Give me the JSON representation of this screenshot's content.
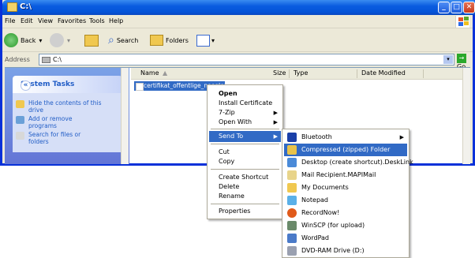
{
  "window": {
    "title": "C:\\",
    "colors": {
      "titlebar": "#0a5ce0",
      "selection": "#316ac5",
      "task_link": "#215dc6"
    }
  },
  "menu": [
    "File",
    "Edit",
    "View",
    "Favorites",
    "Tools",
    "Help"
  ],
  "toolbar": {
    "back": "Back",
    "search": "Search",
    "folders": "Folders"
  },
  "address": {
    "label": "Address",
    "value": "C:\\",
    "go": "Go"
  },
  "tasks": {
    "header": "System Tasks",
    "items": [
      {
        "label": "Hide the contents of this drive",
        "icon": "folder-icon"
      },
      {
        "label": "Add or remove programs",
        "icon": "programs-icon"
      },
      {
        "label": "Search for files or folders",
        "icon": "search-icon"
      }
    ]
  },
  "columns": [
    "Name",
    "Size",
    "Type",
    "Date Modified"
  ],
  "file": {
    "name": "certifikat_offentlige_noegler.cer"
  },
  "context_menu": {
    "items": [
      "Open",
      "Install Certificate",
      "7-Zip",
      "Open With",
      "Send To",
      "Cut",
      "Copy",
      "Create Shortcut",
      "Delete",
      "Rename",
      "Properties"
    ]
  },
  "send_to": {
    "items": [
      {
        "label": "Bluetooth",
        "icon": "bluetooth-icon",
        "color": "#1a3fa8"
      },
      {
        "label": "Compressed (zipped) Folder",
        "icon": "zip-folder-icon",
        "color": "#e8c24a"
      },
      {
        "label": "Desktop (create shortcut).DeskLink",
        "icon": "desktop-icon",
        "color": "#4a8ad8"
      },
      {
        "label": "Mail Recipient.MAPIMail",
        "icon": "mail-icon",
        "color": "#e8d48a"
      },
      {
        "label": "My Documents",
        "icon": "documents-icon",
        "color": "#f0c850"
      },
      {
        "label": "Notepad",
        "icon": "notepad-icon",
        "color": "#5ab0e8"
      },
      {
        "label": "RecordNow!",
        "icon": "recordnow-icon",
        "color": "#e05a1a"
      },
      {
        "label": "WinSCP (for upload)",
        "icon": "winscp-icon",
        "color": "#6a8a6a"
      },
      {
        "label": "WordPad",
        "icon": "wordpad-icon",
        "color": "#4a7ac8"
      },
      {
        "label": "DVD-RAM Drive (D:)",
        "icon": "dvd-drive-icon",
        "color": "#9aa0b0"
      }
    ]
  }
}
